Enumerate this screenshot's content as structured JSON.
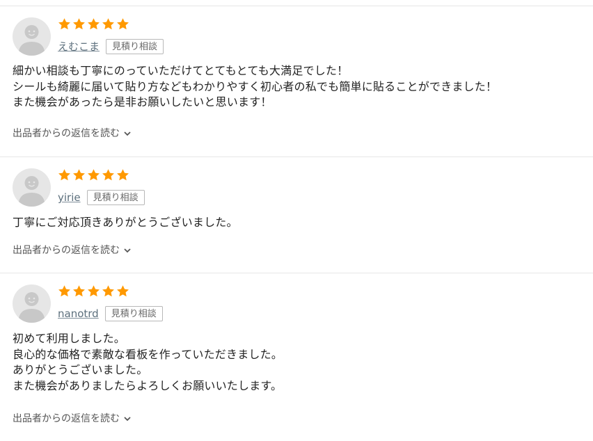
{
  "colors": {
    "star": "#ff9900",
    "avatar_bg": "#e6e6e6",
    "avatar_figure": "#c8c8c8",
    "divider": "#e6e6e6"
  },
  "reviews": [
    {
      "rating": 5,
      "username": "えむこま",
      "tag": "見積り相談",
      "body": [
        "細かい相談も丁寧にのっていただけてとてもとても大満足でした！",
        "シールも綺麗に届いて貼り方などもわかりやすく初心者の私でも簡単に貼ることができました！",
        "また機会があったら是非お願いしたいと思います！"
      ],
      "reply_toggle": "出品者からの返信を読む"
    },
    {
      "rating": 5,
      "username": "yirie",
      "tag": "見積り相談",
      "body": [
        "丁寧にご対応頂きありがとうございました。"
      ],
      "reply_toggle": "出品者からの返信を読む"
    },
    {
      "rating": 5,
      "username": "nanotrd",
      "tag": "見積り相談",
      "body": [
        "初めて利用しました。",
        "良心的な価格で素敵な看板を作っていただきました。",
        "ありがとうございました。",
        "また機会がありましたらよろしくお願いいたします。"
      ],
      "reply_toggle": "出品者からの返信を読む"
    }
  ]
}
